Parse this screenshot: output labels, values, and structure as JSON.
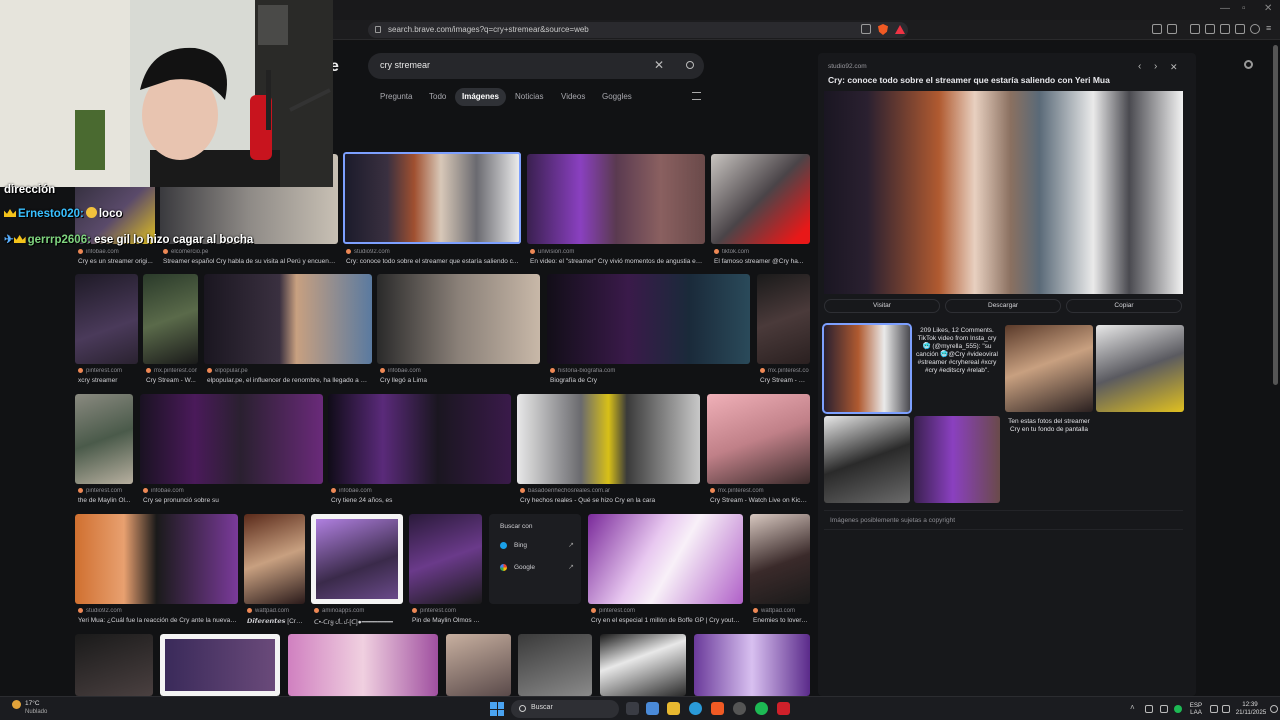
{
  "browser": {
    "url": "search.brave.com/images?q=cry+stremear&source=web"
  },
  "search": {
    "logo_fragment": "e",
    "query": "cry stremear",
    "clear_icon": "close-icon",
    "submit_icon": "search-icon"
  },
  "tabs": [
    "Pregunta",
    "Todo",
    "Imágenes",
    "Noticias",
    "Videos",
    "Goggles"
  ],
  "active_tab": "Imágenes",
  "results": {
    "row1": [
      {
        "src": "infobae.com",
        "cap": "Cry es un streamer origi..."
      },
      {
        "src": "elcomercio.pe",
        "cap": "Streamer español Cry habla de su visita al Perú y encuentr..."
      },
      {
        "src": "studio92.com",
        "cap": "Cry: conoce todo sobre el streamer que estaría saliendo c..."
      },
      {
        "src": "univision.com",
        "cap": "En video: el \"streamer\" Cry vivió momentos de angustia en ..."
      },
      {
        "src": "tiktok.com",
        "cap": "El famoso streamer @Cry ha..."
      }
    ],
    "row2": [
      {
        "src": "pinterest.com",
        "cap": "xcry streamer"
      },
      {
        "src": "mx.pinterest.com",
        "cap": "Cry Stream - W..."
      },
      {
        "src": "elpopular.pe",
        "cap": "elpopular.pe, el influencer de renombre, ha llegado a Perú y quie..."
      },
      {
        "src": "infobae.com",
        "cap": "Cry llegó a Lima"
      },
      {
        "src": "historia-biografia.com",
        "cap": "Biografía de Cry"
      },
      {
        "src": "mx.pinterest.com",
        "cap": "Cry Stream - W..."
      }
    ],
    "row3": [
      {
        "src": "pinterest.com",
        "cap": "the de Maylin Ol..."
      },
      {
        "src": "infobae.com",
        "cap": "Cry se pronunció sobre su"
      },
      {
        "src": "infobae.com",
        "cap": "Cry tiene 24 años, es"
      },
      {
        "src": "basadoenhechosreales.com.ar",
        "cap": "Cry hechos reales - Qué se hizo Cry en la cara"
      },
      {
        "src": "mx.pinterest.com",
        "cap": "Cry Stream - Watch Live on Kick ..."
      }
    ],
    "row4": [
      {
        "src": "studio92.com",
        "cap": "Yeri Mua: ¿Cuál fue la reacción de Cry ante la nueva c..."
      },
      {
        "src": "wattpad.com",
        "cap": "𝘿𝙞𝙛𝙚𝙧𝙚𝙣𝙩𝙚𝙨 [Cry ..."
      },
      {
        "src": "aminoapps.com",
        "cap": "ᑕ•-ᑕгყ ᦔ꒒ᦔ-[ᑕ]●━━━━━━━━"
      },
      {
        "src": "pinterest.com",
        "cap": "Pin de Maylin Olmos S..."
      },
      {
        "src": "pinterest.com",
        "cap": "Cry en el especial 1 millón de Boffe GP | Cry youtub..."
      },
      {
        "src": "wattpad.com",
        "cap": "Enemies to lovers..."
      }
    ]
  },
  "search_with": {
    "title": "Buscar con",
    "engines": [
      "Bing",
      "Google"
    ]
  },
  "panel": {
    "source": "studio92.com",
    "title": "Cry: conoce todo sobre el streamer que estaría saliendo con Yeri Mua",
    "buttons": [
      "Visitar",
      "Descargar",
      "Copiar"
    ],
    "related_texts": [
      "209 Likes, 12 Comments. TikTok video from Insta_cry 🥶 (@myrella_555): \"su canción 🥶@Cry #videoviral #streamer #cryhereal #xcry #cry #editscry #relab\".",
      "Ten estas fotos del streamer Cry en tu fondo de pantalla"
    ],
    "copyright": "Imágenes posiblemente sujetas a copyright"
  },
  "chat": {
    "line1": "dirección",
    "user1": "Ernesto020:",
    "msg1": "loco",
    "user2": "gerrrp2606:",
    "msg2": "ese gil lo hizo cagar al bocha"
  },
  "taskbar": {
    "weather_temp": "17°C",
    "weather_desc": "Nublado",
    "search_label": "Buscar",
    "lang1": "ESP",
    "lang2": "LAA",
    "time": "12:39",
    "date": "21/11/2025"
  },
  "colors": {
    "accent": "#7da0ff",
    "panel_bg": "#17181b",
    "page_bg": "#111214"
  }
}
